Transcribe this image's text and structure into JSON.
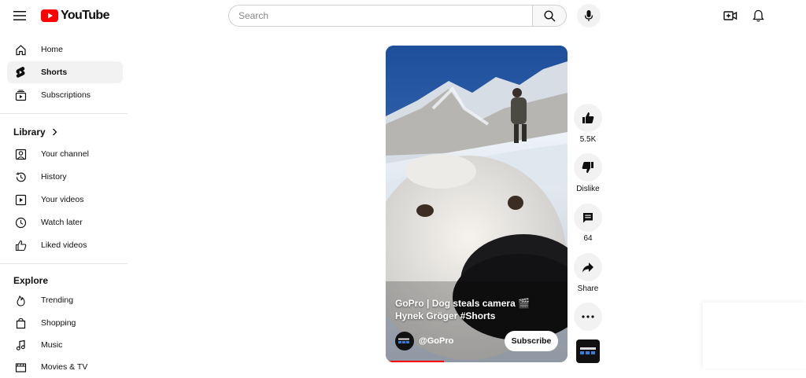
{
  "header": {
    "logo_text": "YouTube",
    "search_placeholder": "Search"
  },
  "sidebar": {
    "main": [
      {
        "label": "Home",
        "icon": "home-icon"
      },
      {
        "label": "Shorts",
        "icon": "shorts-icon",
        "active": true
      },
      {
        "label": "Subscriptions",
        "icon": "subscriptions-icon"
      }
    ],
    "library_title": "Library",
    "library": [
      {
        "label": "Your channel",
        "icon": "account-icon"
      },
      {
        "label": "History",
        "icon": "history-icon"
      },
      {
        "label": "Your videos",
        "icon": "play-square-icon"
      },
      {
        "label": "Watch later",
        "icon": "clock-icon"
      },
      {
        "label": "Liked videos",
        "icon": "thumb-up-icon"
      }
    ],
    "explore_title": "Explore",
    "explore": [
      {
        "label": "Trending",
        "icon": "fire-icon"
      },
      {
        "label": "Shopping",
        "icon": "bag-icon"
      },
      {
        "label": "Music",
        "icon": "music-note-icon"
      },
      {
        "label": "Movies & TV",
        "icon": "film-icon"
      }
    ]
  },
  "short": {
    "title": "GoPro | Dog steals camera 🎬 Hynek Gröger #Shorts",
    "channel": "@GoPro",
    "subscribe_label": "Subscribe",
    "progress": 0.32
  },
  "actions": {
    "likes": "5.5K",
    "dislike_label": "Dislike",
    "comments": "64",
    "share_label": "Share"
  },
  "colors": {
    "accent": "#ff0000",
    "active_bg": "#f2f2f2"
  }
}
